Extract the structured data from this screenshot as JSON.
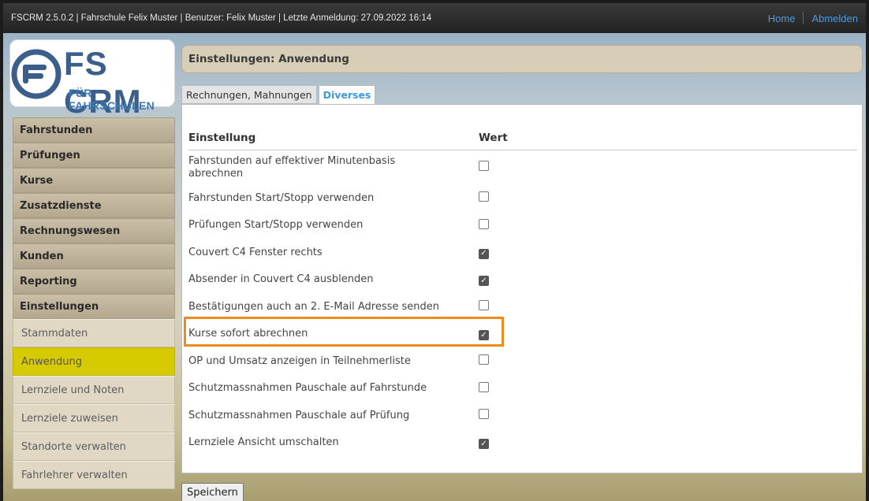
{
  "topbar": {
    "info": "FSCRM 2.5.0.2 | Fahrschule Felix Muster | Benutzer: Felix Muster | Letzte Anmeldung: 27.09.2022 16:14",
    "home": "Home",
    "logout": "Abmelden"
  },
  "logo": {
    "brand": "FS CRM",
    "sub": "FÜR FAHRSCHULEN"
  },
  "sidebar": {
    "main_items": [
      {
        "label": "Fahrstunden"
      },
      {
        "label": "Prüfungen"
      },
      {
        "label": "Kurse"
      },
      {
        "label": "Zusatzdienste"
      },
      {
        "label": "Rechnungswesen"
      },
      {
        "label": "Kunden"
      },
      {
        "label": "Reporting"
      },
      {
        "label": "Einstellungen"
      }
    ],
    "sub_items": [
      {
        "label": "Stammdaten"
      },
      {
        "label": "Anwendung",
        "active": true
      },
      {
        "label": "Lernziele und Noten"
      },
      {
        "label": "Lernziele zuweisen"
      },
      {
        "label": "Standorte verwalten"
      },
      {
        "label": "Fahrlehrer verwalten"
      }
    ]
  },
  "content": {
    "title": "Einstellungen: Anwendung",
    "tabs": [
      {
        "label": "Rechnungen, Mahnungen",
        "active": false
      },
      {
        "label": "Diverses",
        "active": true
      }
    ],
    "table": {
      "header_setting": "Einstellung",
      "header_value": "Wert",
      "rows": [
        {
          "label": "Fahrstunden auf effektiver Minutenbasis abrechnen",
          "checked": false
        },
        {
          "label": "Fahrstunden Start/Stopp verwenden",
          "checked": false
        },
        {
          "label": "Prüfungen Start/Stopp verwenden",
          "checked": false
        },
        {
          "label": "Couvert C4 Fenster rechts",
          "checked": true
        },
        {
          "label": "Absender in Couvert C4 ausblenden",
          "checked": true
        },
        {
          "label": "Bestätigungen auch an 2. E-Mail Adresse senden",
          "checked": false
        },
        {
          "label": "Kurse sofort abrechnen",
          "checked": true
        },
        {
          "label": "OP und Umsatz anzeigen in Teilnehmerliste",
          "checked": false
        },
        {
          "label": "Schutzmassnahmen Pauschale auf Fahrstunde",
          "checked": false
        },
        {
          "label": "Schutzmassnahmen Pauschale auf Prüfung",
          "checked": false
        },
        {
          "label": "Lernziele Ansicht umschalten",
          "checked": true
        }
      ]
    },
    "save_label": "Speichern"
  },
  "colors": {
    "accent": "#3a9ad9",
    "active_nav": "#d5cb00",
    "highlight": "#f08a1c"
  }
}
